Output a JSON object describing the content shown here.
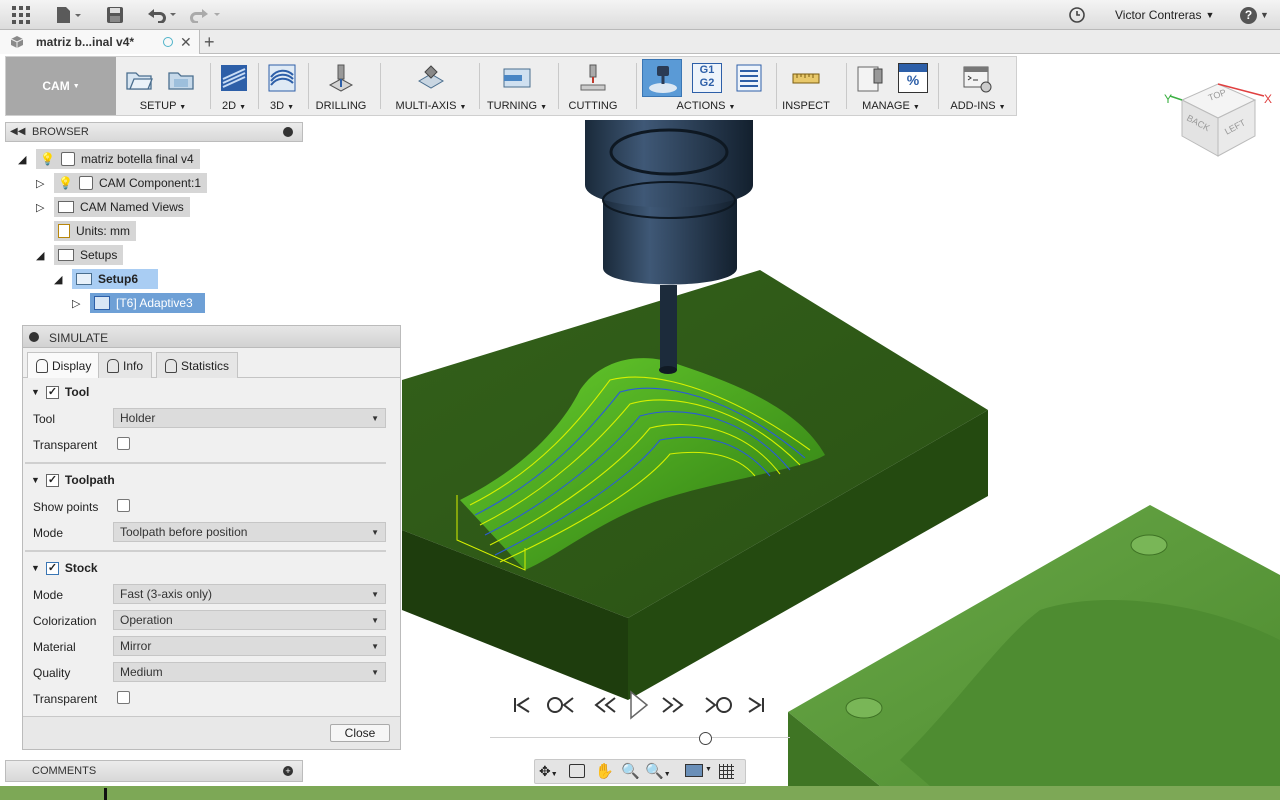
{
  "topbar": {
    "user_name": "Victor Contreras",
    "user_caret": "▼",
    "help_caret": "▼"
  },
  "document_tab": {
    "title": "matriz b...inal v4*"
  },
  "ribbon": {
    "workspace": "CAM",
    "groups": [
      {
        "label": "SETUP",
        "has_menu": true
      },
      {
        "label": "2D",
        "has_menu": true
      },
      {
        "label": "3D",
        "has_menu": true
      },
      {
        "label": "DRILLING",
        "has_menu": false
      },
      {
        "label": "MULTI-AXIS",
        "has_menu": true
      },
      {
        "label": "TURNING",
        "has_menu": true
      },
      {
        "label": "CUTTING",
        "has_menu": false
      },
      {
        "label": "ACTIONS",
        "has_menu": true
      },
      {
        "label": "INSPECT",
        "has_menu": false
      },
      {
        "label": "MANAGE",
        "has_menu": true
      },
      {
        "label": "ADD-INS",
        "has_menu": true
      }
    ],
    "g_code_icon": "G1 G2",
    "manage_icon_text": "%"
  },
  "browser": {
    "title": "BROWSER",
    "tree": [
      {
        "label": "matriz botella final v4"
      },
      {
        "label": "CAM Component:1"
      },
      {
        "label": "CAM Named Views"
      },
      {
        "label": "Units: mm"
      },
      {
        "label": "Setups"
      },
      {
        "label": "Setup6"
      },
      {
        "label": "[T6] Adaptive3"
      }
    ]
  },
  "simulate": {
    "title": "SIMULATE",
    "tabs": [
      "Display",
      "Info",
      "Statistics"
    ],
    "tool_section": {
      "heading": "Tool",
      "tool_label": "Tool",
      "tool_value": "Holder",
      "transparent_label": "Transparent"
    },
    "toolpath_section": {
      "heading": "Toolpath",
      "show_points_label": "Show points",
      "mode_label": "Mode",
      "mode_value": "Toolpath before position"
    },
    "stock_section": {
      "heading": "Stock",
      "mode_label": "Mode",
      "mode_value": "Fast (3-axis only)",
      "colorization_label": "Colorization",
      "colorization_value": "Operation",
      "material_label": "Material",
      "material_value": "Mirror",
      "quality_label": "Quality",
      "quality_value": "Medium",
      "transparent_label": "Transparent"
    },
    "close_label": "Close"
  },
  "comments": {
    "title": "COMMENTS"
  },
  "viewcube": {
    "top": "TOP",
    "back": "BACK",
    "left": "LEFT",
    "axis_x": "X",
    "axis_y": "Y"
  },
  "playback": {
    "position": 0.55
  },
  "colors": {
    "stock_green": "#2f5a14",
    "mold_green": "#5c9a3c",
    "toolpath_yellow": "#d6f000",
    "toolpath_blue": "#2a5cd8",
    "highlight_blue": "#a9cdf3",
    "selected_blue": "#6ea0d6"
  }
}
